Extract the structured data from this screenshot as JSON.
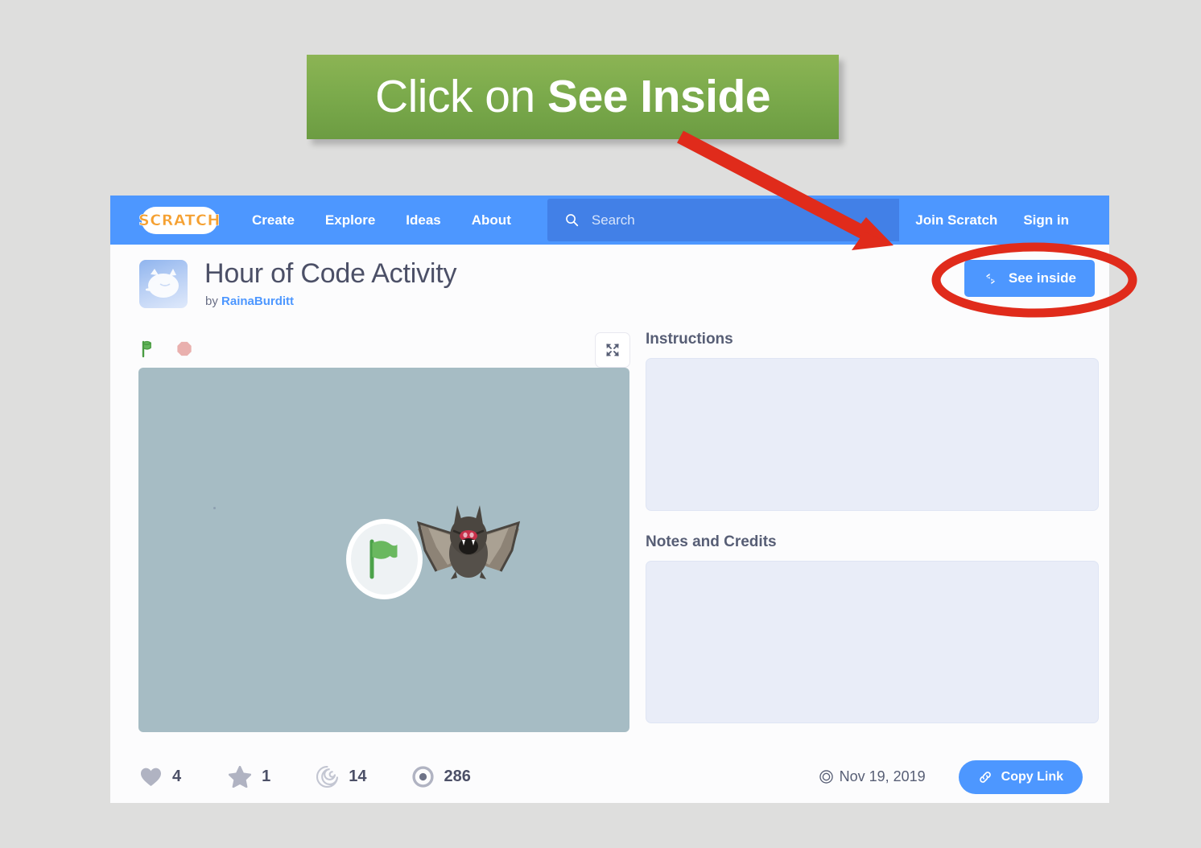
{
  "callout": {
    "text_regular": "Click on ",
    "text_bold": "See Inside",
    "banner_color": "#7cab4c",
    "arrow_color": "#e02b1b",
    "highlight_color": "#e02b1b"
  },
  "nav": {
    "logo_text": "SCRATCH",
    "links": [
      {
        "label": "Create"
      },
      {
        "label": "Explore"
      },
      {
        "label": "Ideas"
      },
      {
        "label": "About"
      }
    ],
    "search": {
      "placeholder": "Search",
      "value": "",
      "icon": "search-icon"
    },
    "account": [
      {
        "label": "Join Scratch"
      },
      {
        "label": "Sign in"
      }
    ],
    "bar_color": "#4d97ff"
  },
  "project": {
    "title": "Hour of Code Activity",
    "by_prefix": "by ",
    "author": "RainaBurditt",
    "see_inside_label": "See inside",
    "avatar_icon": "scratch-cat-avatar"
  },
  "player": {
    "green_flag_icon": "green-flag-icon",
    "stop_icon": "stop-sign-icon",
    "fullscreen_icon": "fullscreen-icon",
    "stage_color": "#a6bcc4",
    "sprite_name": "bat-sprite"
  },
  "info": {
    "instructions_label": "Instructions",
    "instructions_text": "",
    "notes_label": "Notes and Credits",
    "notes_text": ""
  },
  "stats": [
    {
      "name": "loves",
      "icon": "heart-icon",
      "value": "4"
    },
    {
      "name": "favorites",
      "icon": "star-icon",
      "value": "1"
    },
    {
      "name": "remixes",
      "icon": "remix-spiral-icon",
      "value": "14"
    },
    {
      "name": "views",
      "icon": "eye-icon",
      "value": "286"
    }
  ],
  "footer": {
    "shared_date": "Nov 19, 2019",
    "shared_icon": "spiral-target-icon",
    "copy_link_label": "Copy Link",
    "copy_link_icon": "link-icon"
  }
}
